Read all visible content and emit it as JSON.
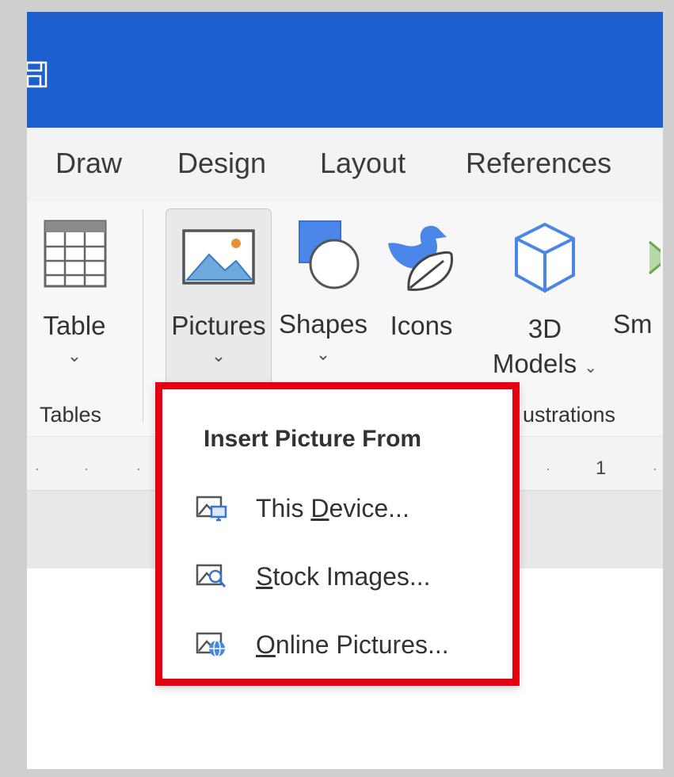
{
  "window": {
    "title_bar_color": "#1e5fd0",
    "save_icon": "save-icon"
  },
  "ribbon_tabs": [
    "Draw",
    "Design",
    "Layout",
    "References"
  ],
  "ribbon": {
    "table": {
      "label": "Table",
      "chevron": "⌄",
      "icon": "table-grid-icon"
    },
    "pictures": {
      "label": "Pictures",
      "chevron": "⌄",
      "icon": "picture-icon"
    },
    "shapes": {
      "label": "Shapes",
      "chevron": "⌄",
      "icon": "shapes-icon"
    },
    "icons": {
      "label": "Icons",
      "icon": "icons-bird-leaf-icon"
    },
    "models3d": {
      "label_line1": "3D",
      "label_line2": "Models",
      "chevron": "⌄",
      "icon": "cube-icon"
    },
    "smartart": {
      "label": "Sm",
      "icon": "smartart-icon"
    },
    "groups": {
      "tables": "Tables",
      "illustrations": "ustrations"
    }
  },
  "ruler": {
    "ticks": [
      "·",
      "·",
      "·",
      "·",
      "·"
    ],
    "number": "1"
  },
  "dropdown": {
    "title": "Insert Picture From",
    "highlight_color": "#e30010",
    "items": [
      {
        "pre": "This ",
        "accel": "D",
        "post": "evice...",
        "icon": "this-device-icon"
      },
      {
        "pre": "",
        "accel": "S",
        "post": "tock Images...",
        "icon": "stock-images-icon"
      },
      {
        "pre": "",
        "accel": "O",
        "post": "nline Pictures...",
        "icon": "online-pictures-icon"
      }
    ]
  }
}
